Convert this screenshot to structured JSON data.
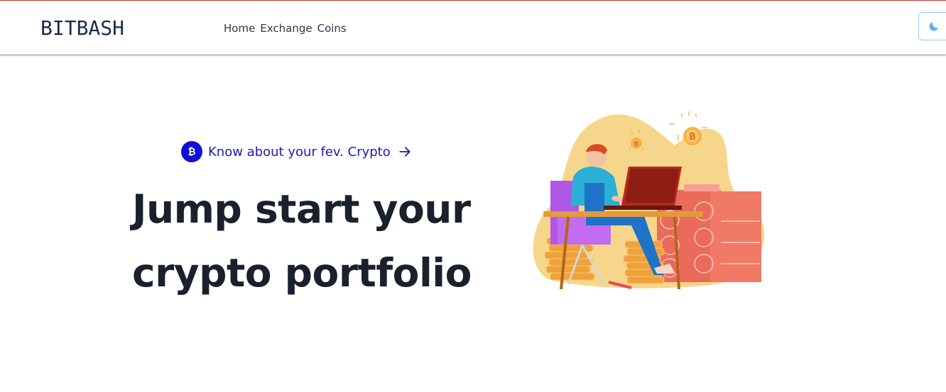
{
  "navbar": {
    "logo": "BITBASH",
    "links": [
      "Home",
      "Exchange",
      "Coins"
    ],
    "theme_toggle_icon": "moon-icon"
  },
  "hero": {
    "tag_icon": "bitcoin-icon",
    "tag_label": "Know about your fev. Crypto",
    "tag_arrow_icon": "arrow-right-icon",
    "title_lines": [
      "Jump start your",
      "crypto portfolio"
    ],
    "illustration": "crypto-mining-illustration"
  },
  "colors": {
    "accent_line": "#c0392b",
    "tag_blue": "#1c1cb3",
    "title": "#1a202c",
    "moon": "#63b3ed"
  }
}
